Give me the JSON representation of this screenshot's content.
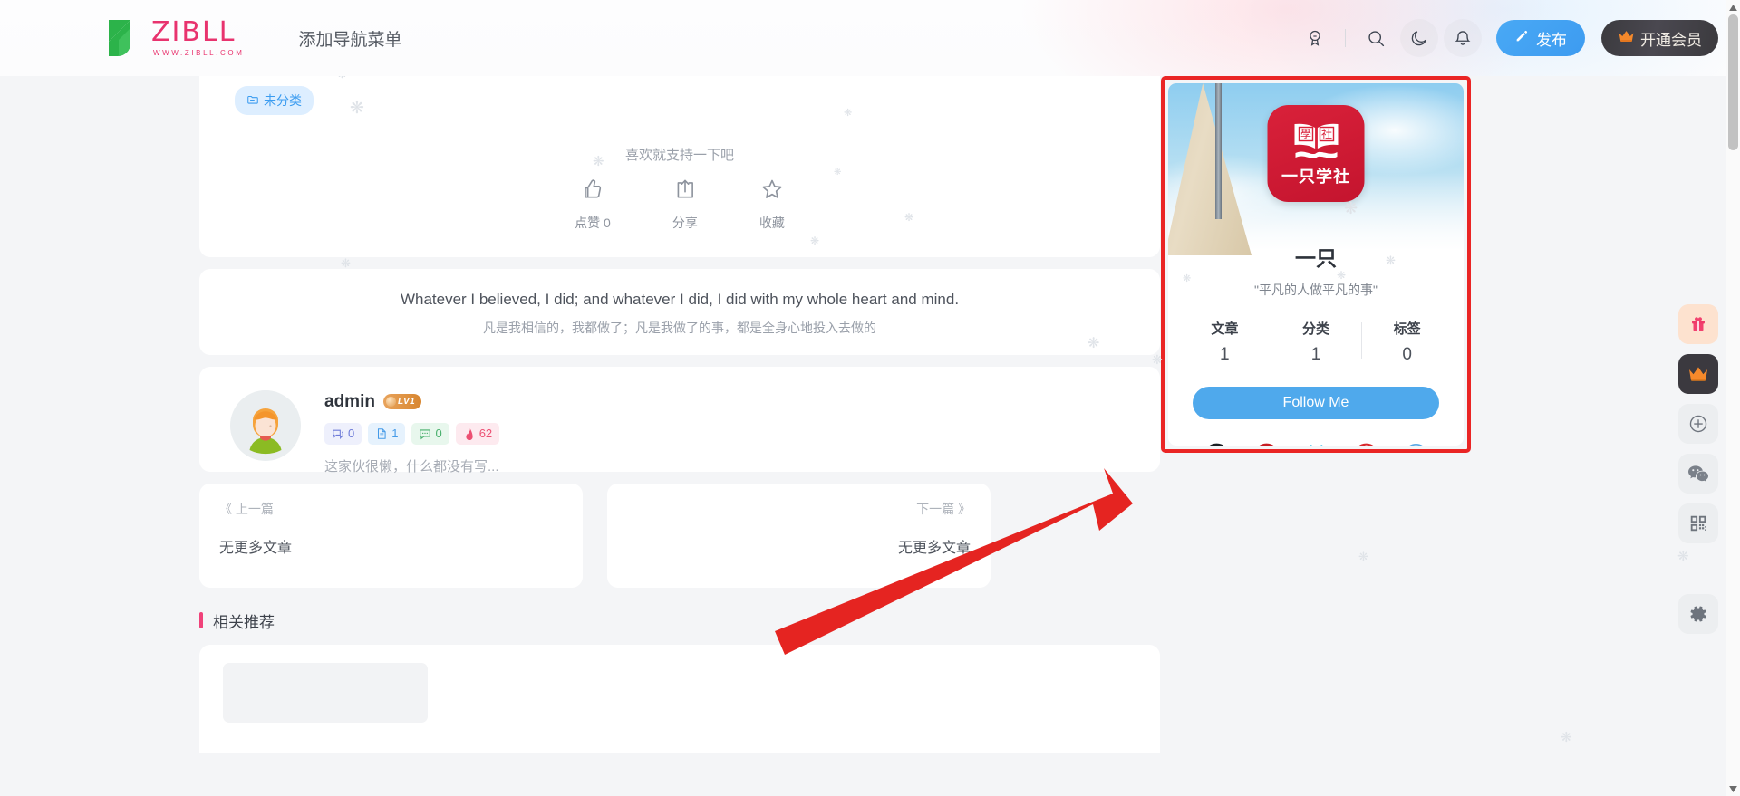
{
  "header": {
    "logo_word": "ZIBLL",
    "logo_sub": "WWW.ZIBLL.COM",
    "nav_item": "添加导航菜单",
    "icons": {
      "medal": "medal-icon",
      "search": "search-icon",
      "dark_mode": "moon-icon",
      "notifications": "bell-icon"
    },
    "publish_label": "发布",
    "vip_label": "开通会员"
  },
  "article_footer": {
    "category_badge": "未分类",
    "support_text": "喜欢就支持一下吧",
    "actions": [
      {
        "name": "like",
        "label": "点赞 0",
        "icon": "thumbs-up-icon"
      },
      {
        "name": "share",
        "label": "分享",
        "icon": "share-icon"
      },
      {
        "name": "favorite",
        "label": "收藏",
        "icon": "star-icon"
      }
    ]
  },
  "quote": {
    "english": "Whatever I believed, I did; and whatever I did, I did with my whole heart and mind.",
    "chinese": "凡是我相信的，我都做了；凡是我做了的事，都是全身心地投入去做的"
  },
  "author": {
    "name": "admin",
    "level_badge": "LV1",
    "stats": [
      {
        "icon": "comments-icon",
        "value": "0"
      },
      {
        "icon": "document-icon",
        "value": "1"
      },
      {
        "icon": "message-icon",
        "value": "0"
      },
      {
        "icon": "fire-icon",
        "value": "62"
      }
    ],
    "bio": "这家伙很懒，什么都没有写..."
  },
  "pagination": {
    "prev_label": "《 上一篇",
    "prev_title": "无更多文章",
    "next_label": "下一篇 》",
    "next_title": "无更多文章"
  },
  "related": {
    "title": "相关推荐"
  },
  "profile": {
    "avatar_logo_text": "一只学社",
    "name": "一只",
    "tagline": "\"平凡的人做平凡的事\"",
    "stats": [
      {
        "label": "文章",
        "value": "1"
      },
      {
        "label": "分类",
        "value": "1"
      },
      {
        "label": "标签",
        "value": "0"
      }
    ],
    "follow_label": "Follow Me",
    "socials": [
      {
        "name": "github-icon",
        "color": "#1b1f23"
      },
      {
        "name": "gitee-icon",
        "color": "#c71d23"
      },
      {
        "name": "bilibili-icon",
        "color": "#2eb8e6"
      },
      {
        "name": "netease-music-icon",
        "color": "#d8282c"
      },
      {
        "name": "info-icon",
        "color": "#5aa9e6"
      }
    ]
  },
  "floatbar": {
    "items": [
      {
        "name": "gift-icon",
        "style": "gift"
      },
      {
        "name": "crown-icon",
        "style": "vip"
      },
      {
        "name": "plus-circle-icon",
        "style": "plain"
      },
      {
        "name": "wechat-icon",
        "style": "plain"
      },
      {
        "name": "qrcode-icon",
        "style": "plain"
      },
      {
        "name": "gear-icon",
        "style": "gear"
      }
    ]
  },
  "colors": {
    "brand_pink": "#e8336e",
    "brand_green": "#2cb34a",
    "accent_blue": "#4fa9ec",
    "annotation_red": "#ea2525",
    "related_bar": "#f0427a"
  }
}
